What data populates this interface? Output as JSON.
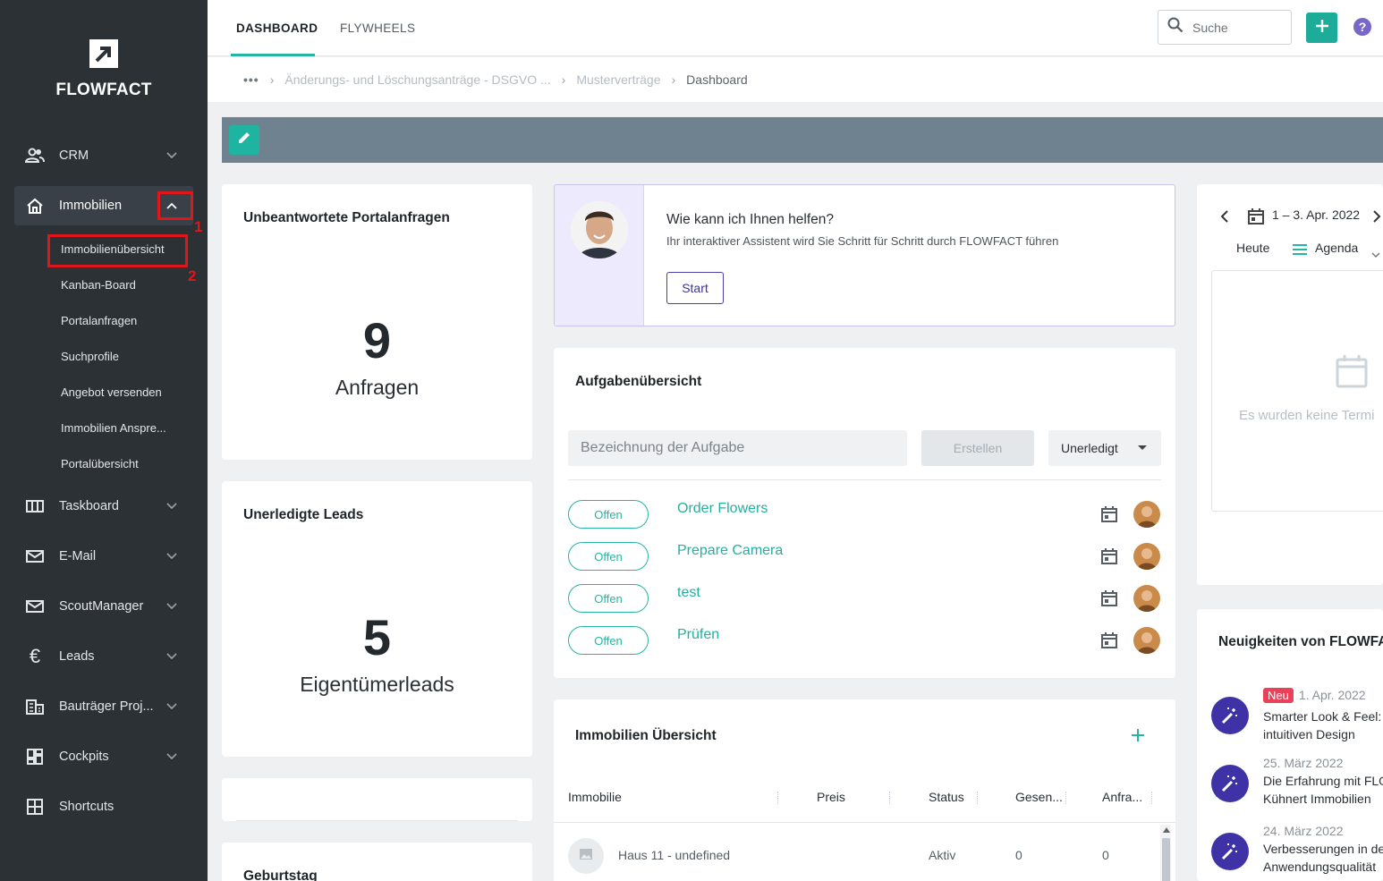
{
  "brand": {
    "name": "FLOWFACT"
  },
  "sidebar": {
    "items": [
      {
        "label": "CRM",
        "icon": "people-icon"
      },
      {
        "label": "Immobilien",
        "icon": "home-icon"
      },
      {
        "label": "Taskboard",
        "icon": "board-icon"
      },
      {
        "label": "E-Mail",
        "icon": "mail-icon"
      },
      {
        "label": "ScoutManager",
        "icon": "mail-icon"
      },
      {
        "label": "Leads",
        "icon": "euro-icon"
      },
      {
        "label": "Bauträger Proj...",
        "icon": "building-icon"
      },
      {
        "label": "Cockpits",
        "icon": "dashboard-icon"
      },
      {
        "label": "Shortcuts",
        "icon": "grid-icon"
      }
    ],
    "subitems": [
      "Immobilienübersicht",
      "Kanban-Board",
      "Portalanfragen",
      "Suchprofile",
      "Angebot versenden",
      "Immobilien Anspre...",
      "Portalübersicht"
    ],
    "annotations": [
      "1",
      "2"
    ]
  },
  "topbar": {
    "tabs": [
      "DASHBOARD",
      "FLYWHEELS"
    ],
    "search_placeholder": "Suche",
    "help_label": "?"
  },
  "breadcrumb": {
    "dots": "•••",
    "items": [
      "Änderungs- und Löschungsanträge - DSGVO ...",
      "Musterverträge",
      "Dashboard"
    ]
  },
  "portal_card": {
    "title": "Unbeantwortete Portalanfragen",
    "count": "9",
    "label": "Anfragen"
  },
  "leads_card": {
    "title": "Unerledigte Leads",
    "count": "5",
    "label": "Eigentümerleads"
  },
  "birthday_card": {
    "title": "Geburtstag"
  },
  "assistant": {
    "title": "Wie kann ich Ihnen helfen?",
    "subtitle": "Ihr interaktiver Assistent wird Sie Schritt für Schritt durch FLOWFACT führen",
    "button": "Start"
  },
  "tasks": {
    "title": "Aufgabenübersicht",
    "input_placeholder": "Bezeichnung der Aufgabe",
    "create_label": "Erstellen",
    "filter_value": "Unerledigt",
    "rows": [
      {
        "status": "Offen",
        "name": "Order Flowers"
      },
      {
        "status": "Offen",
        "name": "Prepare Camera"
      },
      {
        "status": "Offen",
        "name": "test"
      },
      {
        "status": "Offen",
        "name": "Prüfen"
      }
    ]
  },
  "properties": {
    "title": "Immobilien Übersicht",
    "columns": [
      "Immobilie",
      "Preis",
      "Status",
      "Gesen...",
      "Anfra..."
    ],
    "rows": [
      {
        "name": "Haus 11 - undefined",
        "price": "",
        "status": "Aktiv",
        "sent": "0",
        "requests": "0"
      }
    ]
  },
  "calendar": {
    "range": "1 – 3. Apr. 2022",
    "today": "Heute",
    "view": "Agenda",
    "empty": "Es wurden keine Termi"
  },
  "news": {
    "title": "Neuigkeiten von FLOWFA",
    "items": [
      {
        "badge": "Neu",
        "date": "1. Apr. 2022",
        "line1": "Smarter Look & Feel:",
        "line2": "intuitiven Design"
      },
      {
        "badge": "",
        "date": "25. März 2022",
        "line1": "Die Erfahrung mit FLO",
        "line2": "Kühnert Immobilien"
      },
      {
        "badge": "",
        "date": "24. März 2022",
        "line1": "Verbesserungen in de",
        "line2": "Anwendungsqualität"
      }
    ]
  },
  "colors": {
    "accent": "#26b5a4",
    "sidebar": "#2c3136",
    "band": "#6e8290",
    "purple": "#3f32a6",
    "annotation": "#e0161b"
  }
}
